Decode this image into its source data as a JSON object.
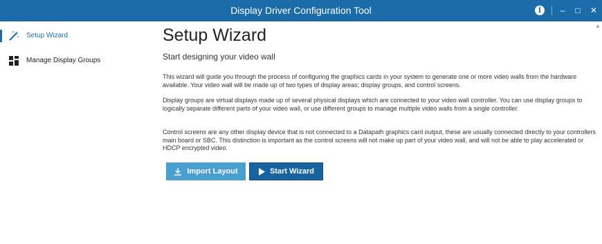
{
  "window": {
    "title": "Display Driver Configuration Tool",
    "controls": {
      "minimize": "–",
      "maximize": "□",
      "close": "✕",
      "info": "i"
    }
  },
  "sidebar": {
    "items": [
      {
        "label": "Setup Wizard",
        "icon": "magic-wand-icon",
        "active": true
      },
      {
        "label": "Manage Display Groups",
        "icon": "grid-icon",
        "active": false
      }
    ]
  },
  "main": {
    "title": "Setup Wizard",
    "subtitle": "Start designing your video wall",
    "paragraphs": [
      "This wizard will guide you through the process of configuring the graphics cards in your system to generate one or more video walls from the hardware available. Your video wall will be made up of two types of display areas; display groups, and control screens.",
      "Display groups are virtual displays made up of several physical displays which are connected to your video wall controller. You can use display groups to logically separate different parts of your video wall, or use different groups to manage multiple video walls from a single controller.",
      "Control screens are any other display device that is not connected to a Datapath graphics card output, these are usually connected directly to your controllers main board or SBC. This distinction is important as the control screens will not make up part of your video wall, and will not be able to play accelerated or HDCP encrypted video."
    ],
    "buttons": {
      "import": {
        "label": "Import Layout",
        "icon": "download-icon"
      },
      "start": {
        "label": "Start Wizard",
        "icon": "play-icon"
      }
    }
  },
  "colors": {
    "titlebar": "#1a6ba8",
    "import_button": "#4a9fd1",
    "start_button": "#1763a0"
  }
}
